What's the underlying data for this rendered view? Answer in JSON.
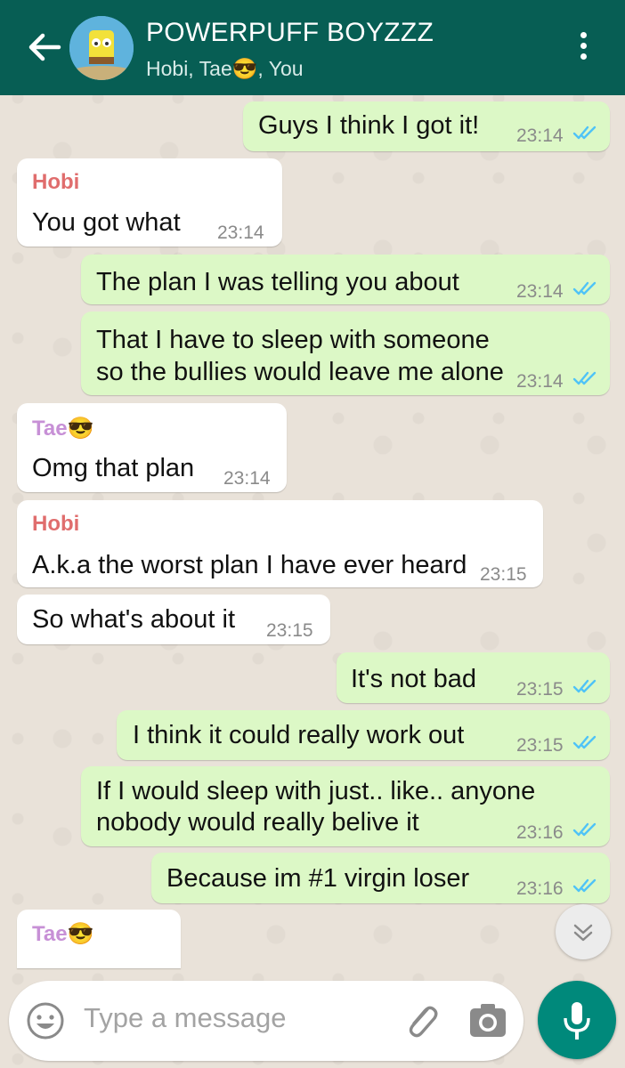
{
  "header": {
    "title": "POWERPUFF BOYZZZ",
    "subtitle": "Hobi, Tae😎, You",
    "accent": "#075e54"
  },
  "messages": [
    {
      "dir": "out",
      "text": "Guys I think I got it!",
      "time": "23:14",
      "status": "read"
    },
    {
      "dir": "in",
      "sender": "Hobi",
      "text": "You got what",
      "time": "23:14"
    },
    {
      "dir": "out",
      "text": "The plan I was telling you about",
      "time": "23:14",
      "status": "read"
    },
    {
      "dir": "out",
      "lines": [
        "That I have to sleep with someone",
        "so the bullies would leave me alone"
      ],
      "time": "23:14",
      "status": "read"
    },
    {
      "dir": "in",
      "sender": "Tae😎",
      "text": "Omg that plan",
      "time": "23:14"
    },
    {
      "dir": "in",
      "sender": "Hobi",
      "text": "A.k.a the worst plan I have ever heard",
      "time": "23:15"
    },
    {
      "dir": "in",
      "text": "So what's about it",
      "time": "23:15"
    },
    {
      "dir": "out",
      "text": "It's not bad",
      "time": "23:15",
      "status": "read"
    },
    {
      "dir": "out",
      "text": "I think it could really work out",
      "time": "23:15",
      "status": "read"
    },
    {
      "dir": "out",
      "lines": [
        "If I would sleep with just.. like.. anyone",
        "nobody would really belive it"
      ],
      "time": "23:16",
      "status": "read"
    },
    {
      "dir": "out",
      "text": "Because im #1 virgin loser",
      "time": "23:16",
      "status": "read"
    },
    {
      "dir": "in",
      "sender": "Tae😎",
      "text": "",
      "time": ""
    }
  ],
  "composer": {
    "placeholder": "Type a message",
    "icons": [
      "emoji-icon",
      "attachment-icon",
      "camera-icon",
      "microphone-icon"
    ]
  },
  "colors": {
    "outgoing_bubble": "#dcf8c6",
    "incoming_bubble": "#ffffff",
    "read_tick": "#4fc3f7",
    "send_button": "#00897b"
  }
}
